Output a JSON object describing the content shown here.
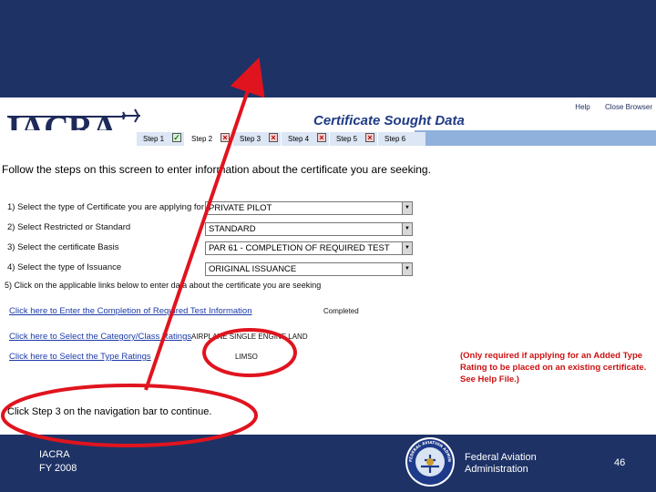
{
  "app": {
    "logo": "IACRA",
    "page_heading": "Certificate Sought Data",
    "help_link": "Help",
    "close_browser_link": "Close Browser"
  },
  "nav": {
    "steps": [
      {
        "label": "Step 1",
        "status": "check"
      },
      {
        "label": "Step 2",
        "status": "cross"
      },
      {
        "label": "Step 3",
        "status": "cross"
      },
      {
        "label": "Step 4",
        "status": "cross"
      },
      {
        "label": "Step 5",
        "status": "cross"
      },
      {
        "label": "Step 6",
        "status": "none"
      }
    ]
  },
  "form": {
    "instruction": "Follow the steps on this screen to enter information about the certificate you are seeking.",
    "fields": [
      {
        "label": "1) Select the type of Certificate you are applying for",
        "value": "PRIVATE PILOT"
      },
      {
        "label": "2) Select Restricted or Standard",
        "value": "STANDARD"
      },
      {
        "label": "3) Select the certificate Basis",
        "value": "PAR 61 - COMPLETION OF REQUIRED TEST"
      },
      {
        "label": "4) Select the type of Issuance",
        "value": "ORIGINAL ISSUANCE"
      }
    ],
    "step5": "5) Click on the applicable links below to enter data about the certificate you are seeking",
    "links": [
      {
        "label": "Click here to Enter the Completion of Required Test Information",
        "value": "Completed"
      },
      {
        "label": "Click here to Select the Category/Class Ratings",
        "value": "AIRPLANE SINGLE ENGINE LAND"
      },
      {
        "label": "Click here to Select the Type Ratings",
        "value": "LIMSO"
      }
    ],
    "note": "(Only required if applying for an Added Type Rating to be placed on an existing certificate. See Help File.)",
    "continue_text": "Click Step 3 on the navigation bar to continue."
  },
  "footer": {
    "org_line1": "IACRA",
    "org_line2": "FY 2008",
    "agency_line1": "Federal Aviation",
    "agency_line2": "Administration",
    "seal_text": "FEDERAL AVIATION ADMINISTRATION",
    "page_number": "46"
  },
  "colors": {
    "slide_background": "#1e3266",
    "annotation_red": "#e0141e",
    "link_blue": "#1b3aa8"
  }
}
